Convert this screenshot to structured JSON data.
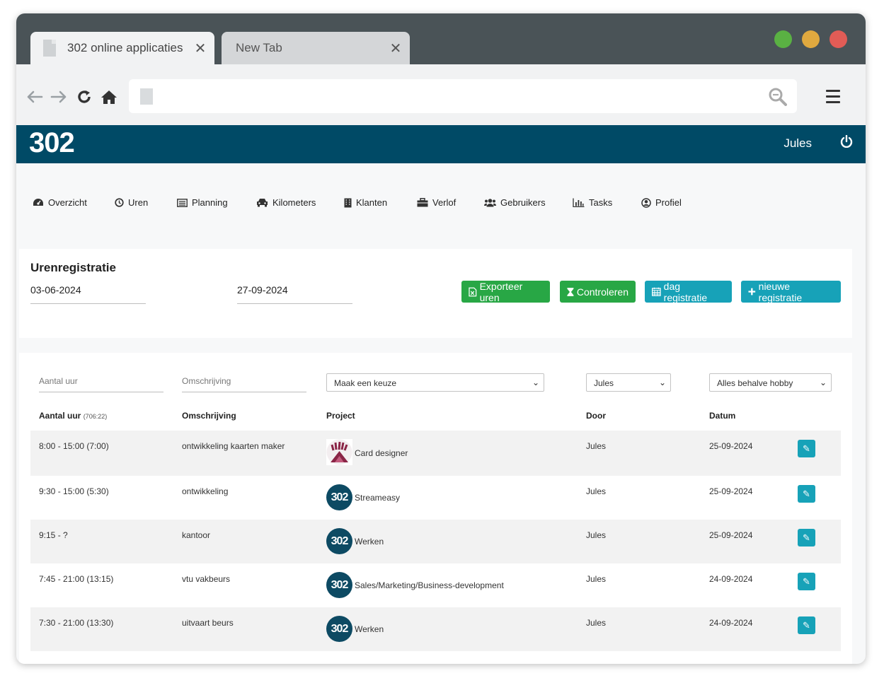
{
  "browser": {
    "tabs": [
      {
        "title": "302 online applicaties",
        "close": "✕"
      },
      {
        "title": "New Tab",
        "close": "✕"
      }
    ],
    "window_dots": [
      "#5ab143",
      "#e0a93f",
      "#e25c56"
    ]
  },
  "app": {
    "logo": "302",
    "user": "Jules"
  },
  "nav": [
    {
      "label": "Overzicht",
      "icon": "dashboard-icon"
    },
    {
      "label": "Uren",
      "icon": "clock-icon"
    },
    {
      "label": "Planning",
      "icon": "calendar-list-icon"
    },
    {
      "label": "Kilometers",
      "icon": "car-icon"
    },
    {
      "label": "Klanten",
      "icon": "building-icon"
    },
    {
      "label": "Verlof",
      "icon": "suitcase-icon"
    },
    {
      "label": "Gebruikers",
      "icon": "users-icon"
    },
    {
      "label": "Tasks",
      "icon": "bar-chart-icon"
    },
    {
      "label": "Profiel",
      "icon": "user-circle-icon"
    }
  ],
  "page": {
    "title": "Urenregistratie",
    "date_from": "03-06-2024",
    "date_to": "27-09-2024",
    "buttons": {
      "export": "Exporteer uren",
      "check": "Controleren",
      "day": "dag registratie",
      "new": "nieuwe registratie"
    }
  },
  "filters": {
    "hours_placeholder": "Aantal uur",
    "description_placeholder": "Omschrijving",
    "project_select": "Maak een keuze",
    "user_select": "Jules",
    "type_select": "Alles behalve hobby"
  },
  "table": {
    "headers": {
      "hours": "Aantal uur",
      "hours_total": "(706:22)",
      "description": "Omschrijving",
      "project": "Project",
      "by": "Door",
      "date": "Datum"
    },
    "rows": [
      {
        "hours": "8:00 - 15:00 (7:00)",
        "description": "ontwikkeling kaarten maker",
        "project": "Card designer",
        "logo": "card",
        "by": "Jules",
        "date": "25-09-2024"
      },
      {
        "hours": "9:30 - 15:00 (5:30)",
        "description": "ontwikkeling",
        "project": "Streameasy",
        "logo": "302",
        "by": "Jules",
        "date": "25-09-2024"
      },
      {
        "hours": "9:15 - ?",
        "description": "kantoor",
        "project": "Werken",
        "logo": "302",
        "by": "Jules",
        "date": "25-09-2024"
      },
      {
        "hours": "7:45 - 21:00 (13:15)",
        "description": "vtu vakbeurs",
        "project": "Sales/Marketing/Business-development",
        "logo": "302",
        "by": "Jules",
        "date": "24-09-2024"
      },
      {
        "hours": "7:30 - 21:00 (13:30)",
        "description": "uitvaart beurs",
        "project": "Werken",
        "logo": "302",
        "by": "Jules",
        "date": "24-09-2024"
      }
    ]
  }
}
